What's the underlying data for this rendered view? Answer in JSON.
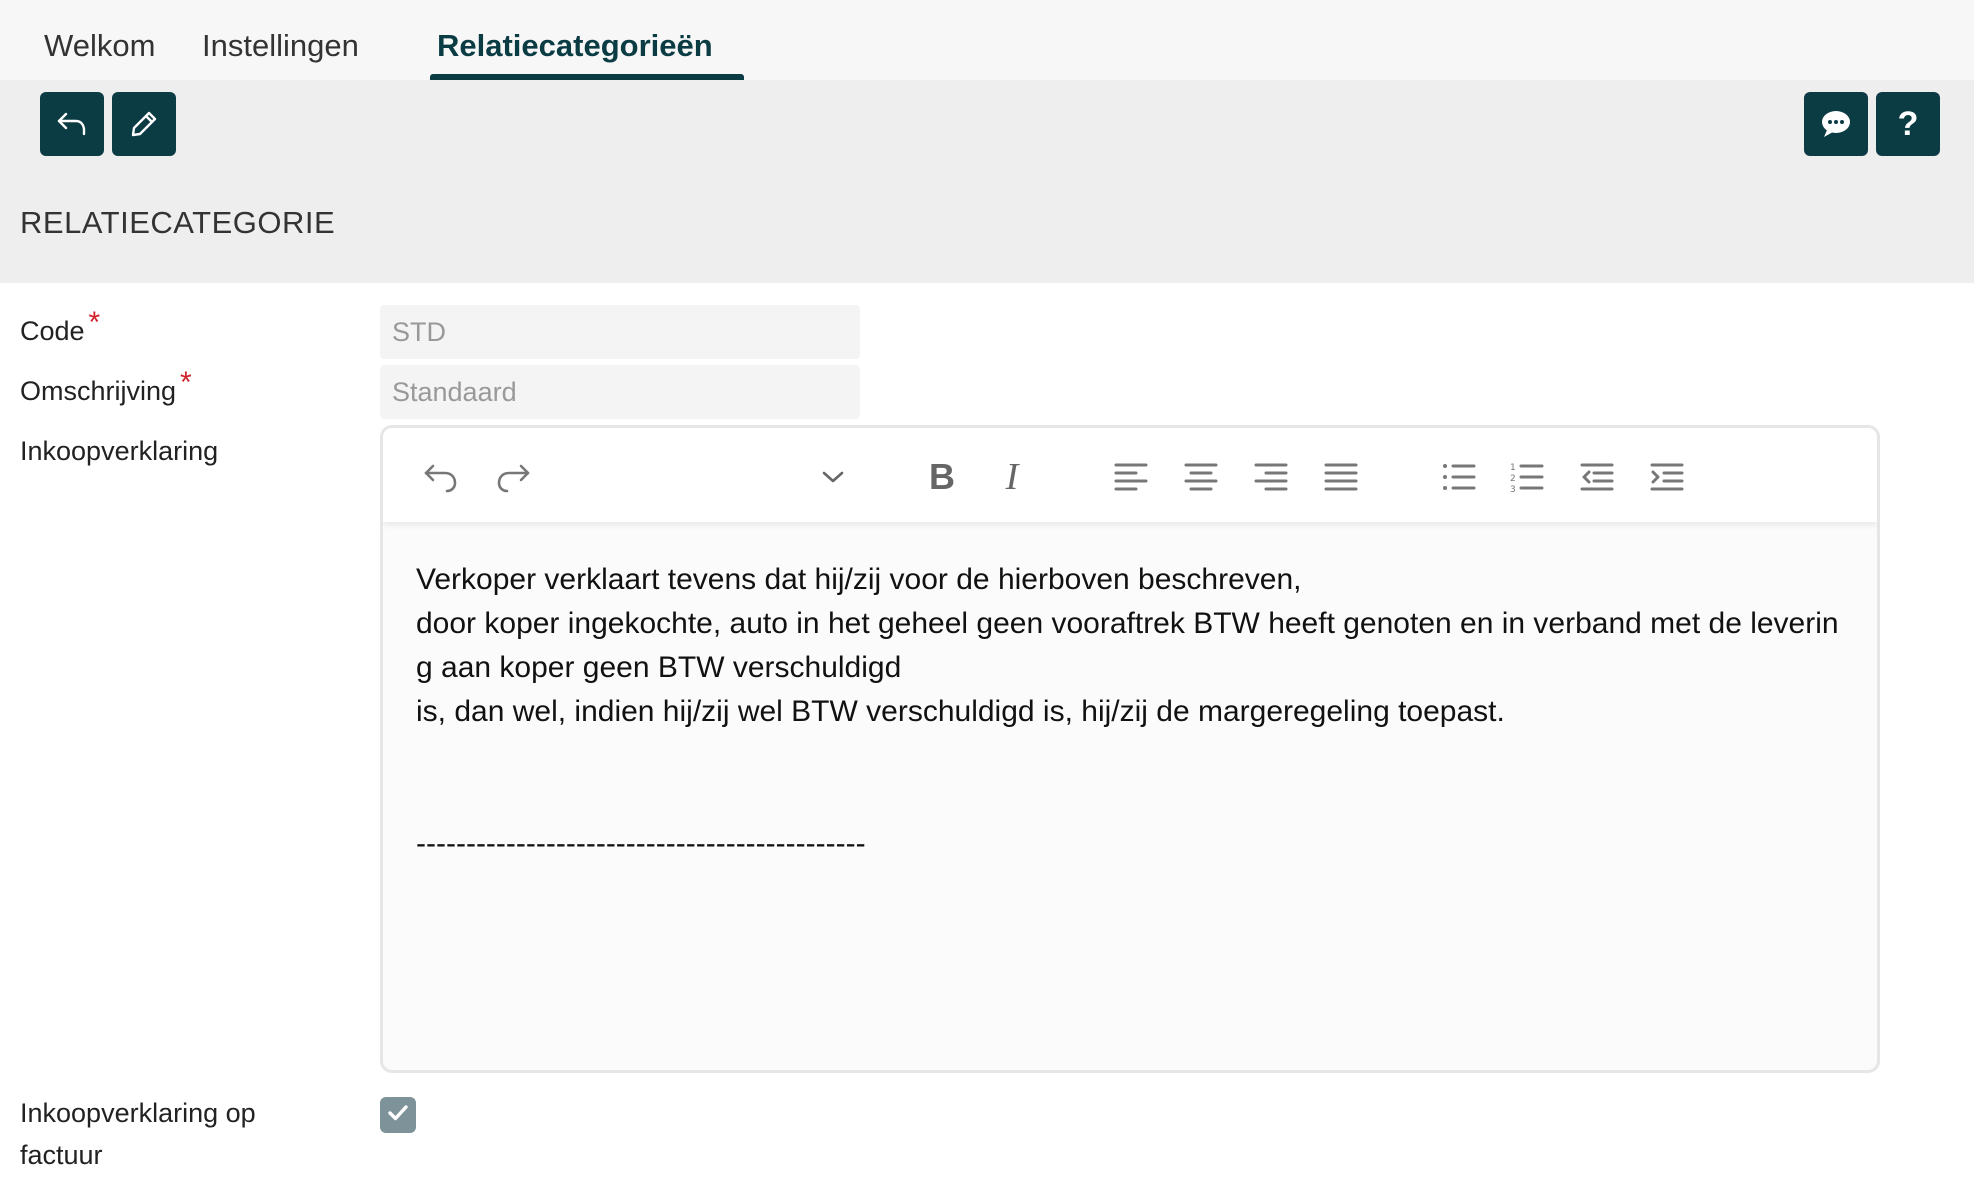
{
  "tabs": [
    {
      "label": "Welkom"
    },
    {
      "label": "Instellingen"
    },
    {
      "label": "Relatiecategorieën",
      "active": true
    }
  ],
  "toolbar": {
    "left_icons": [
      "back-arrow-icon",
      "pencil-icon"
    ],
    "right_icons": [
      "chat-icon",
      "help-icon"
    ],
    "help_label": "?"
  },
  "section": {
    "title": "RELATIECATEGORIE"
  },
  "form": {
    "code": {
      "label": "Code",
      "required_mark": "*",
      "value": "STD"
    },
    "omschrijving": {
      "label": "Omschrijving",
      "required_mark": "*",
      "value": "Standaard"
    },
    "inkoopverklaring": {
      "label": "Inkoopverklaring",
      "text": "Verkoper verklaart tevens dat hij/zij voor de hierboven beschreven,\ndoor koper ingekochte, auto in het geheel geen vooraftrek BTW heeft genoten en in verband met de levering aan koper geen BTW verschuldigd\nis, dan wel, indien hij/zij wel BTW verschuldigd is, hij/zij de margeregeling toepast.\n\n\n---------------------------------------------"
    },
    "inkoopverklaring_op_factuur": {
      "label_line1": "Inkoopverklaring op",
      "label_line2": "factuur",
      "checked": true
    }
  },
  "editor_toolbar": {
    "bold_label": "B",
    "italic_label": "I",
    "icons": [
      "undo-icon",
      "redo-icon",
      "chevron-down-icon",
      "bold-icon",
      "italic-icon",
      "align-left-icon",
      "align-center-icon",
      "align-right-icon",
      "align-justify-icon",
      "bullet-list-icon",
      "numbered-list-icon",
      "outdent-icon",
      "indent-icon"
    ]
  },
  "colors": {
    "accent": "#0b3c44",
    "band": "#eeeeee",
    "required": "#d0202a",
    "checkbox": "#7d9399"
  }
}
